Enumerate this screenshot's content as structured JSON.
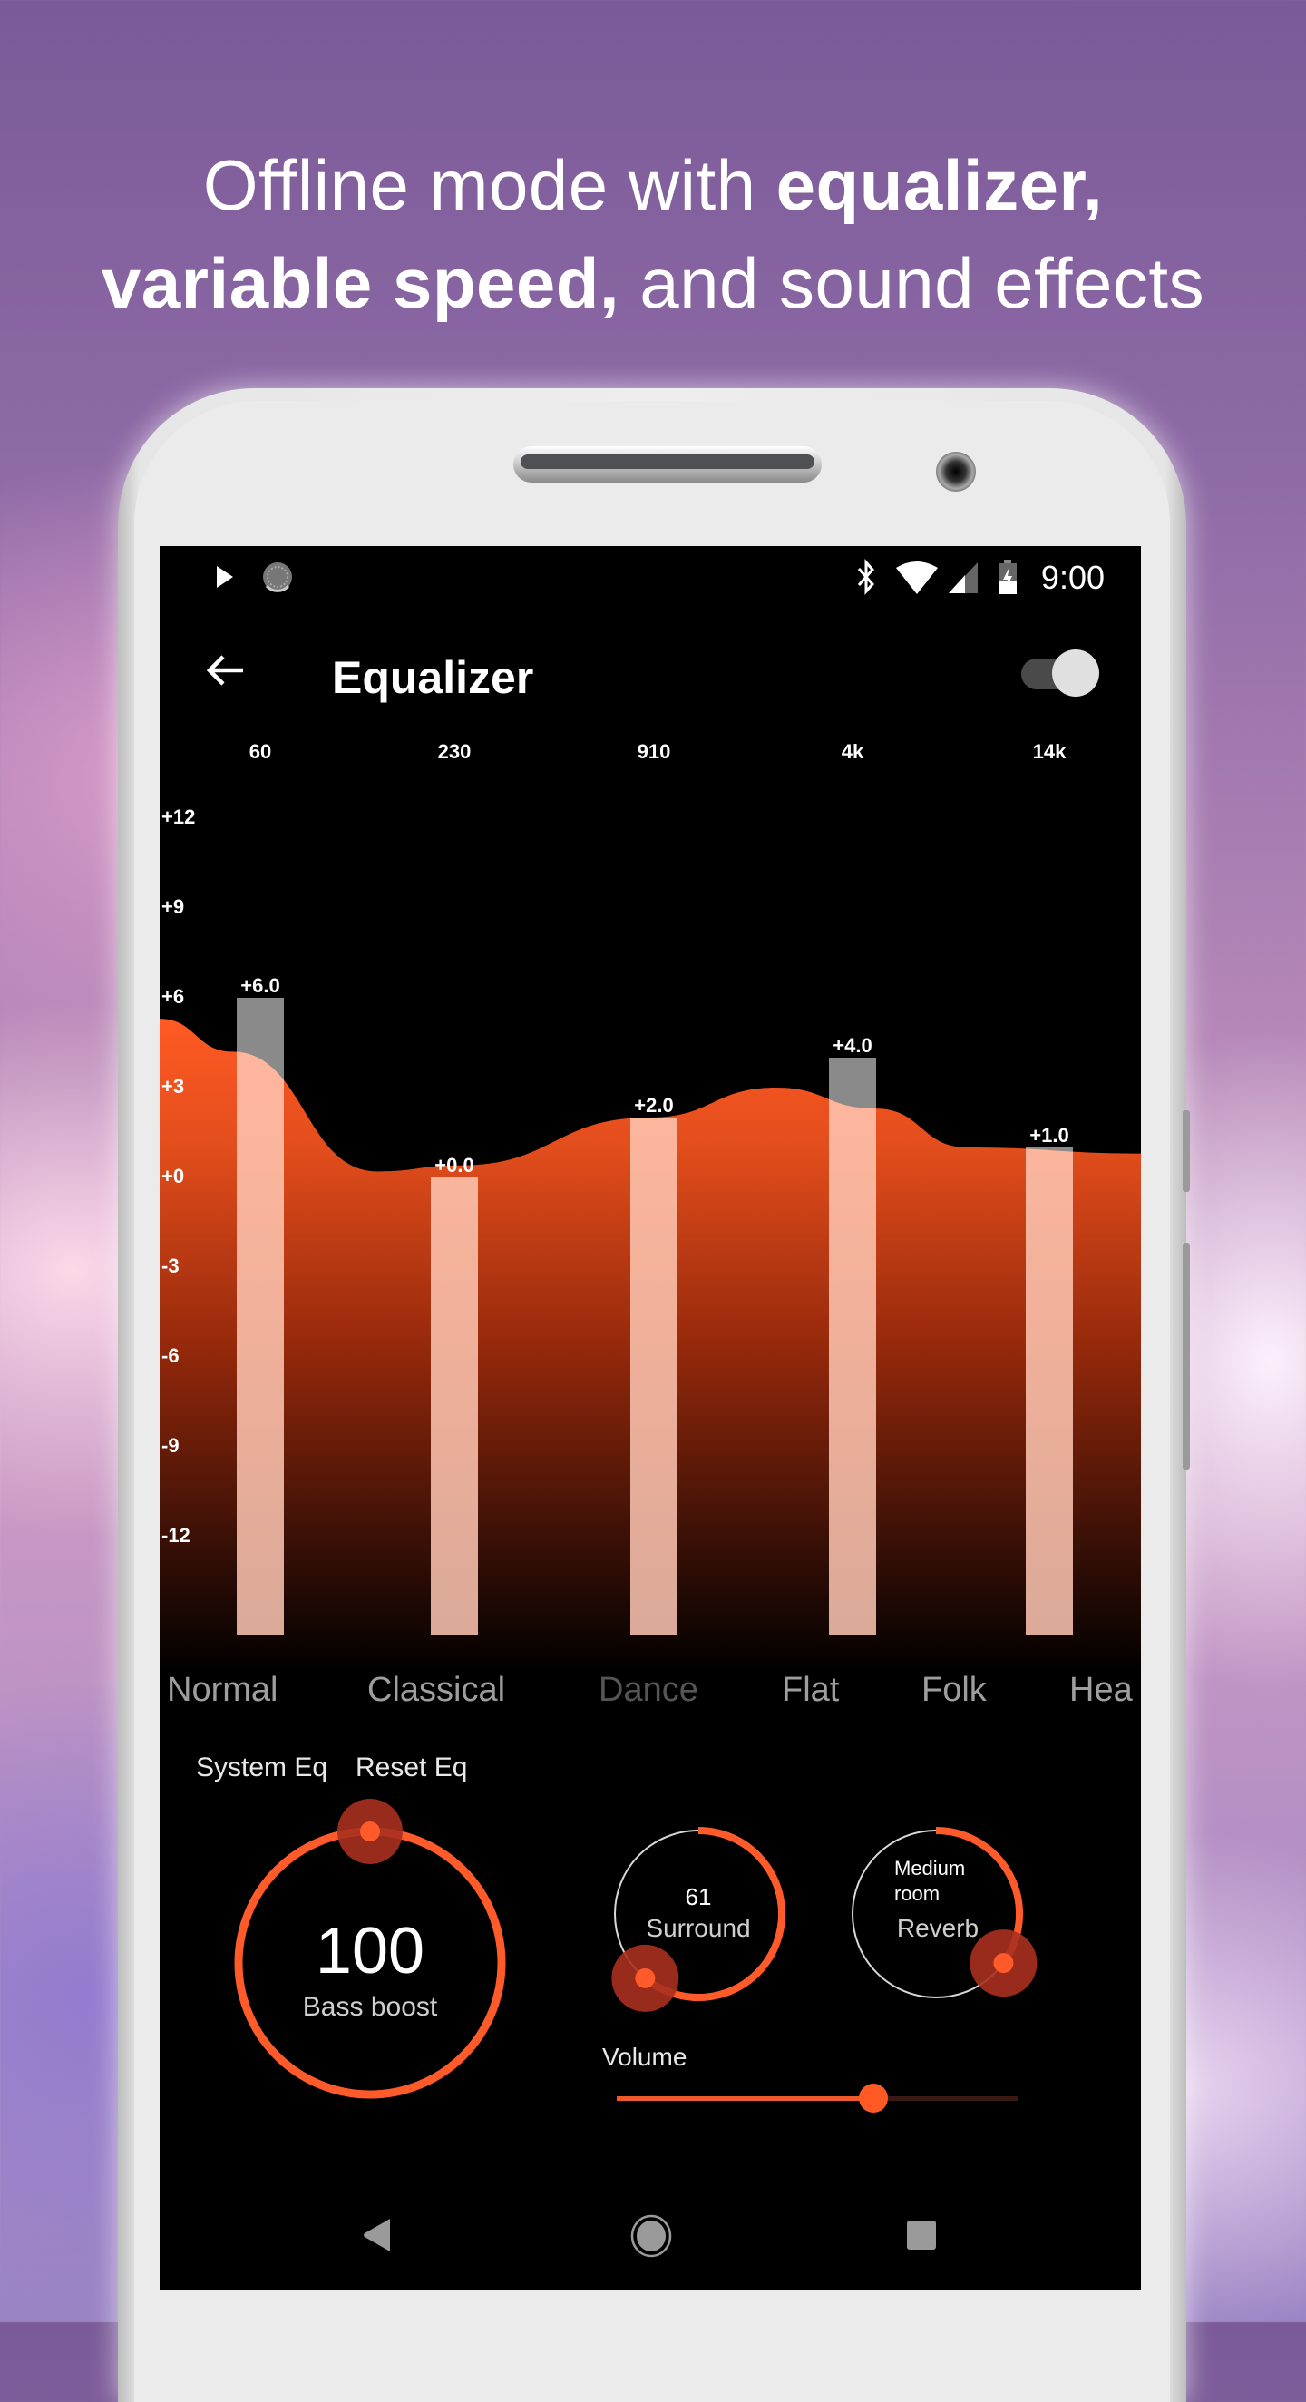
{
  "headline": {
    "line1_light": "Offline mode with ",
    "line1_bold": "equalizer,",
    "line2_bold": "variable speed,",
    "line2_light": " and sound effects"
  },
  "status_bar": {
    "left_icons": [
      "play-icon",
      "sync-icon"
    ],
    "right_icons": [
      "bluetooth-icon",
      "wifi-icon",
      "signal-icon",
      "battery-charging-icon"
    ],
    "time": "9:00"
  },
  "app_bar": {
    "back_icon": "arrow-left-icon",
    "title": "Equalizer",
    "toggle_on": true
  },
  "colors": {
    "accent": "#ff5722",
    "accent_dark": "#a33020",
    "bar": "#8a8a8a",
    "background": "#000000"
  },
  "chart_data": {
    "type": "bar",
    "title": "",
    "categories": [
      "60",
      "230",
      "910",
      "4k",
      "14k"
    ],
    "values": [
      6.0,
      0.0,
      2.0,
      4.0,
      1.0
    ],
    "value_labels": [
      "+6.0",
      "+0.0",
      "+2.0",
      "+4.0",
      "+1.0"
    ],
    "y_ticks": [
      "+12",
      "+9",
      "+6",
      "+3",
      "+0",
      "-3",
      "-6",
      "-9",
      "-12"
    ],
    "y_tick_values": [
      12,
      9,
      6,
      3,
      0,
      -3,
      -6,
      -9,
      -12
    ],
    "ylim": [
      -15,
      12
    ],
    "xlabel": "",
    "ylabel": "",
    "grid": false,
    "curve": "smooth area through band gains"
  },
  "presets": [
    {
      "label": "Normal",
      "state": "normal"
    },
    {
      "label": "Classical",
      "state": "normal"
    },
    {
      "label": "Dance",
      "state": "dim"
    },
    {
      "label": "Flat",
      "state": "normal"
    },
    {
      "label": "Folk",
      "state": "normal"
    },
    {
      "label": "Hea",
      "state": "normal"
    }
  ],
  "eq_buttons": {
    "system": "System Eq",
    "reset": "Reset Eq"
  },
  "bass_boost": {
    "value": "100",
    "label": "Bass boost",
    "fraction": 1.0
  },
  "surround": {
    "value": "61",
    "label": "Surround",
    "fraction": 0.61
  },
  "reverb": {
    "value_line1": "Medium",
    "value_line2": "room",
    "label": "Reverb",
    "fraction": 0.35
  },
  "volume": {
    "label": "Volume",
    "fraction": 0.64
  },
  "nav_bar": {
    "icons": [
      "nav-back-icon",
      "nav-home-icon",
      "nav-recents-icon"
    ]
  }
}
